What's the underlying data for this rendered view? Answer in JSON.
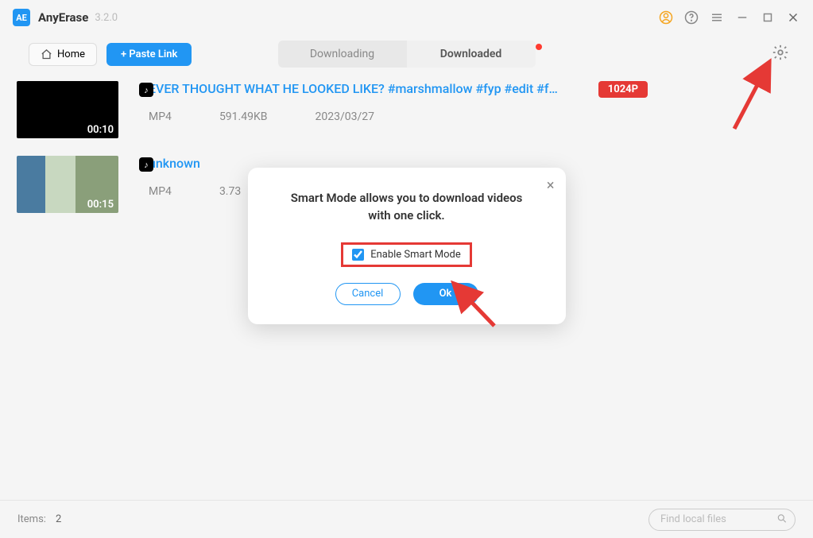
{
  "app": {
    "logo": "AE",
    "name": "AnyErase",
    "version": "3.2.0"
  },
  "toolbar": {
    "home_label": "Home",
    "paste_label": "+ Paste Link",
    "seg_downloading": "Downloading",
    "seg_downloaded": "Downloaded"
  },
  "items": [
    {
      "duration": "00:10",
      "tiktok": "♪",
      "title": "EVER THOUGHT WHAT HE LOOKED LIKE? #marshmallow #fyp #edit #f…",
      "format": "MP4",
      "size": "591.49KB",
      "date": "2023/03/27",
      "quality": "1024P"
    },
    {
      "duration": "00:15",
      "tiktok": "♪",
      "title": "unknown",
      "format": "MP4",
      "size": "3.73",
      "date": "",
      "quality": ""
    }
  ],
  "modal": {
    "text": "Smart Mode allows you to download videos with one click.",
    "checkbox_label": "Enable Smart Mode",
    "cancel_label": "Cancel",
    "ok_label": "Ok"
  },
  "footer": {
    "items_label": "Items:",
    "items_count": "2",
    "search_placeholder": "Find local files"
  }
}
